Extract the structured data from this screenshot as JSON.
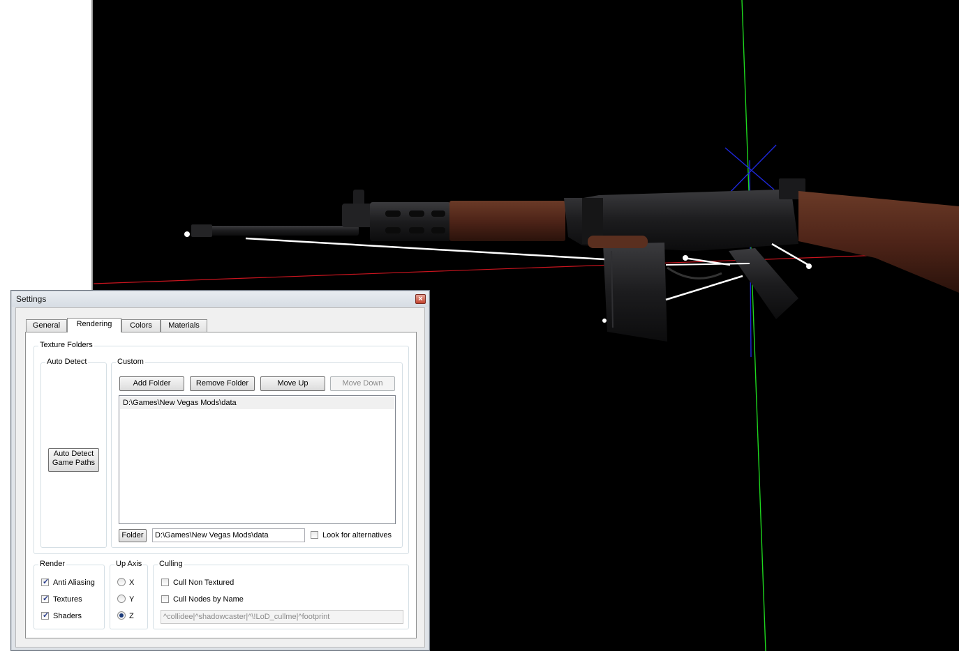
{
  "dialog": {
    "title": "Settings",
    "close_glyph": "×"
  },
  "tabs": [
    {
      "label": "General",
      "active": false
    },
    {
      "label": "Rendering",
      "active": true
    },
    {
      "label": "Colors",
      "active": false
    },
    {
      "label": "Materials",
      "active": false
    }
  ],
  "texture_folders": {
    "group_label": "Texture Folders",
    "auto_detect": {
      "group_label": "Auto Detect",
      "button_line1": "Auto Detect",
      "button_line2": "Game Paths"
    },
    "custom": {
      "group_label": "Custom",
      "add_folder": "Add Folder",
      "remove_folder": "Remove Folder",
      "move_up": "Move Up",
      "move_down": "Move Down",
      "folders": [
        "D:\\Games\\New Vegas Mods\\data"
      ],
      "folder_button": "Folder",
      "folder_path_value": "D:\\Games\\New Vegas Mods\\data",
      "look_for_alternatives": "Look for alternatives",
      "look_for_alternatives_checked": false
    }
  },
  "render": {
    "group_label": "Render",
    "anti_aliasing": "Anti Aliasing",
    "textures": "Textures",
    "shaders": "Shaders",
    "check_glyph": "✓"
  },
  "up_axis": {
    "group_label": "Up Axis",
    "options": [
      "X",
      "Y",
      "Z"
    ],
    "selected": "Z"
  },
  "culling": {
    "group_label": "Culling",
    "cull_non_textured": "Cull Non Textured",
    "cull_nodes_by_name": "Cull Nodes by Name",
    "pattern_value": "^collidee|^shadowcaster|^\\!LoD_cullme|^footprint"
  },
  "colors": {
    "x_axis": "#c8141e",
    "y_axis": "#1ed61e",
    "z_axis": "#1e28dc",
    "wood": "#4e2418",
    "metal": "#1c1c1e"
  }
}
